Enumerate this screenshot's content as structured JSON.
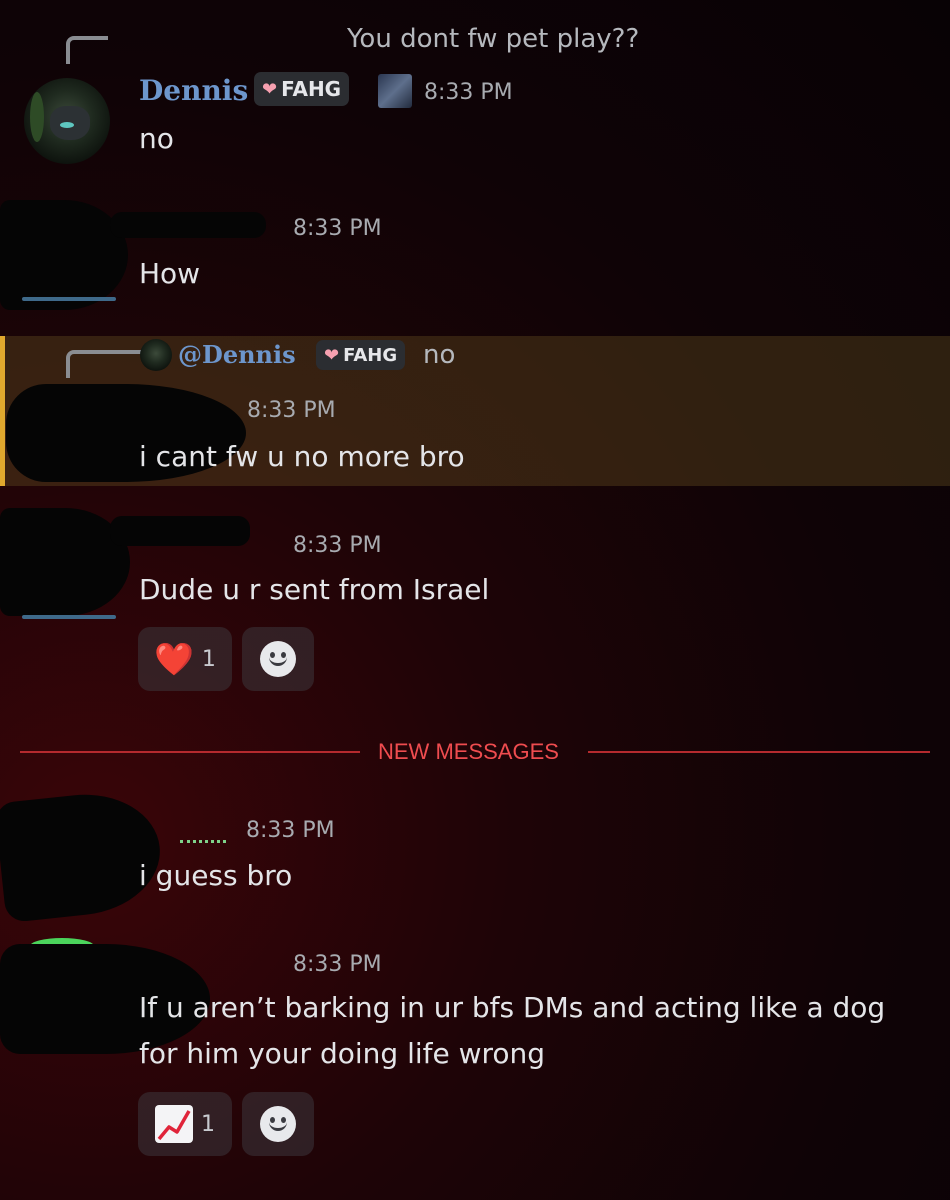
{
  "reply_context_1": "You dont fw pet play??",
  "messages": [
    {
      "username": "Dennis",
      "tag": "FAHG",
      "time": "8:33 PM",
      "text": "no"
    },
    {
      "time": "8:33 PM",
      "text": "How"
    },
    {
      "reply_mention": "@Dennis",
      "reply_tag": "FAHG",
      "reply_text": "no",
      "time": "8:33 PM",
      "text": "i cant fw u no more bro"
    },
    {
      "time": "8:33 PM",
      "text": "Dude u r sent from Israel",
      "reaction_emoji": "❤️",
      "reaction_count": "1"
    },
    {
      "time": "8:33 PM",
      "text": "i guess bro"
    },
    {
      "time": "8:33 PM",
      "text_line1": "If u aren’t barking in ur bfs DMs and acting like a dog",
      "text_line2": "for him your doing life wrong",
      "reaction_emoji": "📈",
      "reaction_count": "1"
    }
  ],
  "divider_label": "NEW MESSAGES",
  "colors": {
    "username": "#6d96cc",
    "highlight_bar": "#e0a82e",
    "new_messages": "#ef4c4f"
  }
}
